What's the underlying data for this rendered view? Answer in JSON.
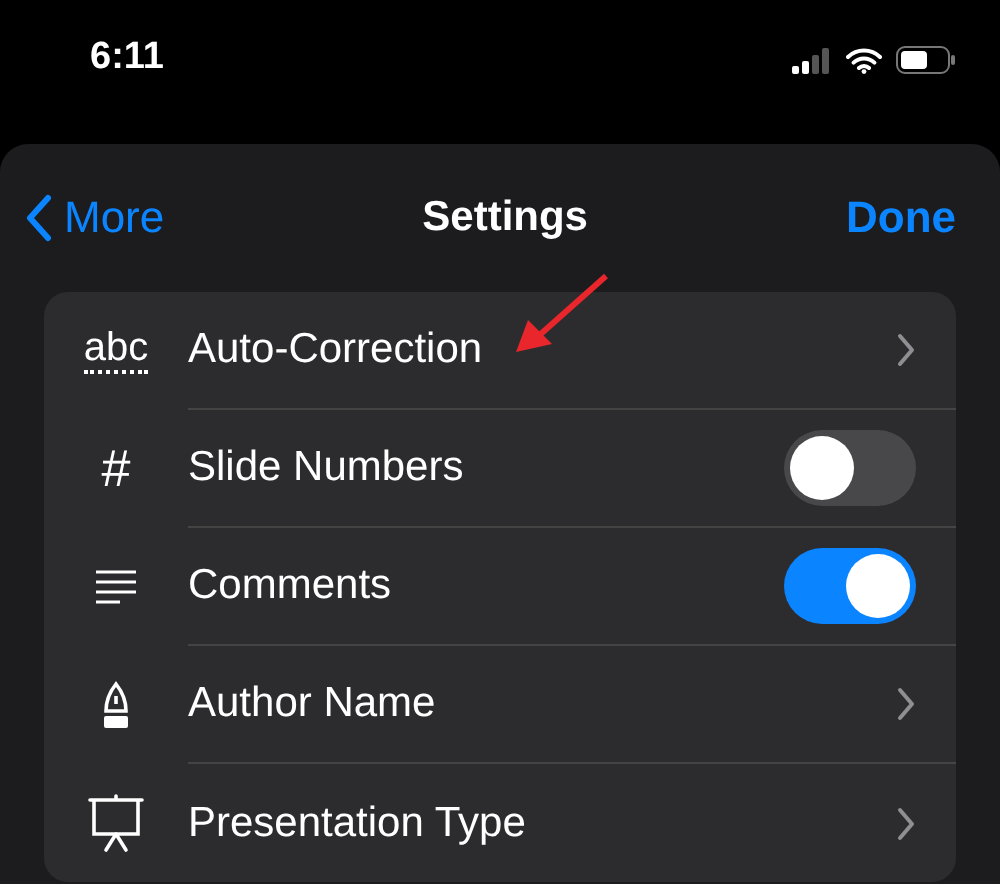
{
  "status_bar": {
    "time": "6:11"
  },
  "nav": {
    "back": "More",
    "title": "Settings",
    "done": "Done"
  },
  "rows": [
    {
      "kind": "link",
      "glyph": "abc",
      "label": "Auto-Correction"
    },
    {
      "kind": "toggle",
      "glyph": "#",
      "label": "Slide Numbers",
      "on": false
    },
    {
      "kind": "toggle",
      "label": "Comments",
      "on": true
    },
    {
      "kind": "link",
      "label": "Author Name"
    },
    {
      "kind": "link",
      "label": "Presentation Type"
    }
  ]
}
